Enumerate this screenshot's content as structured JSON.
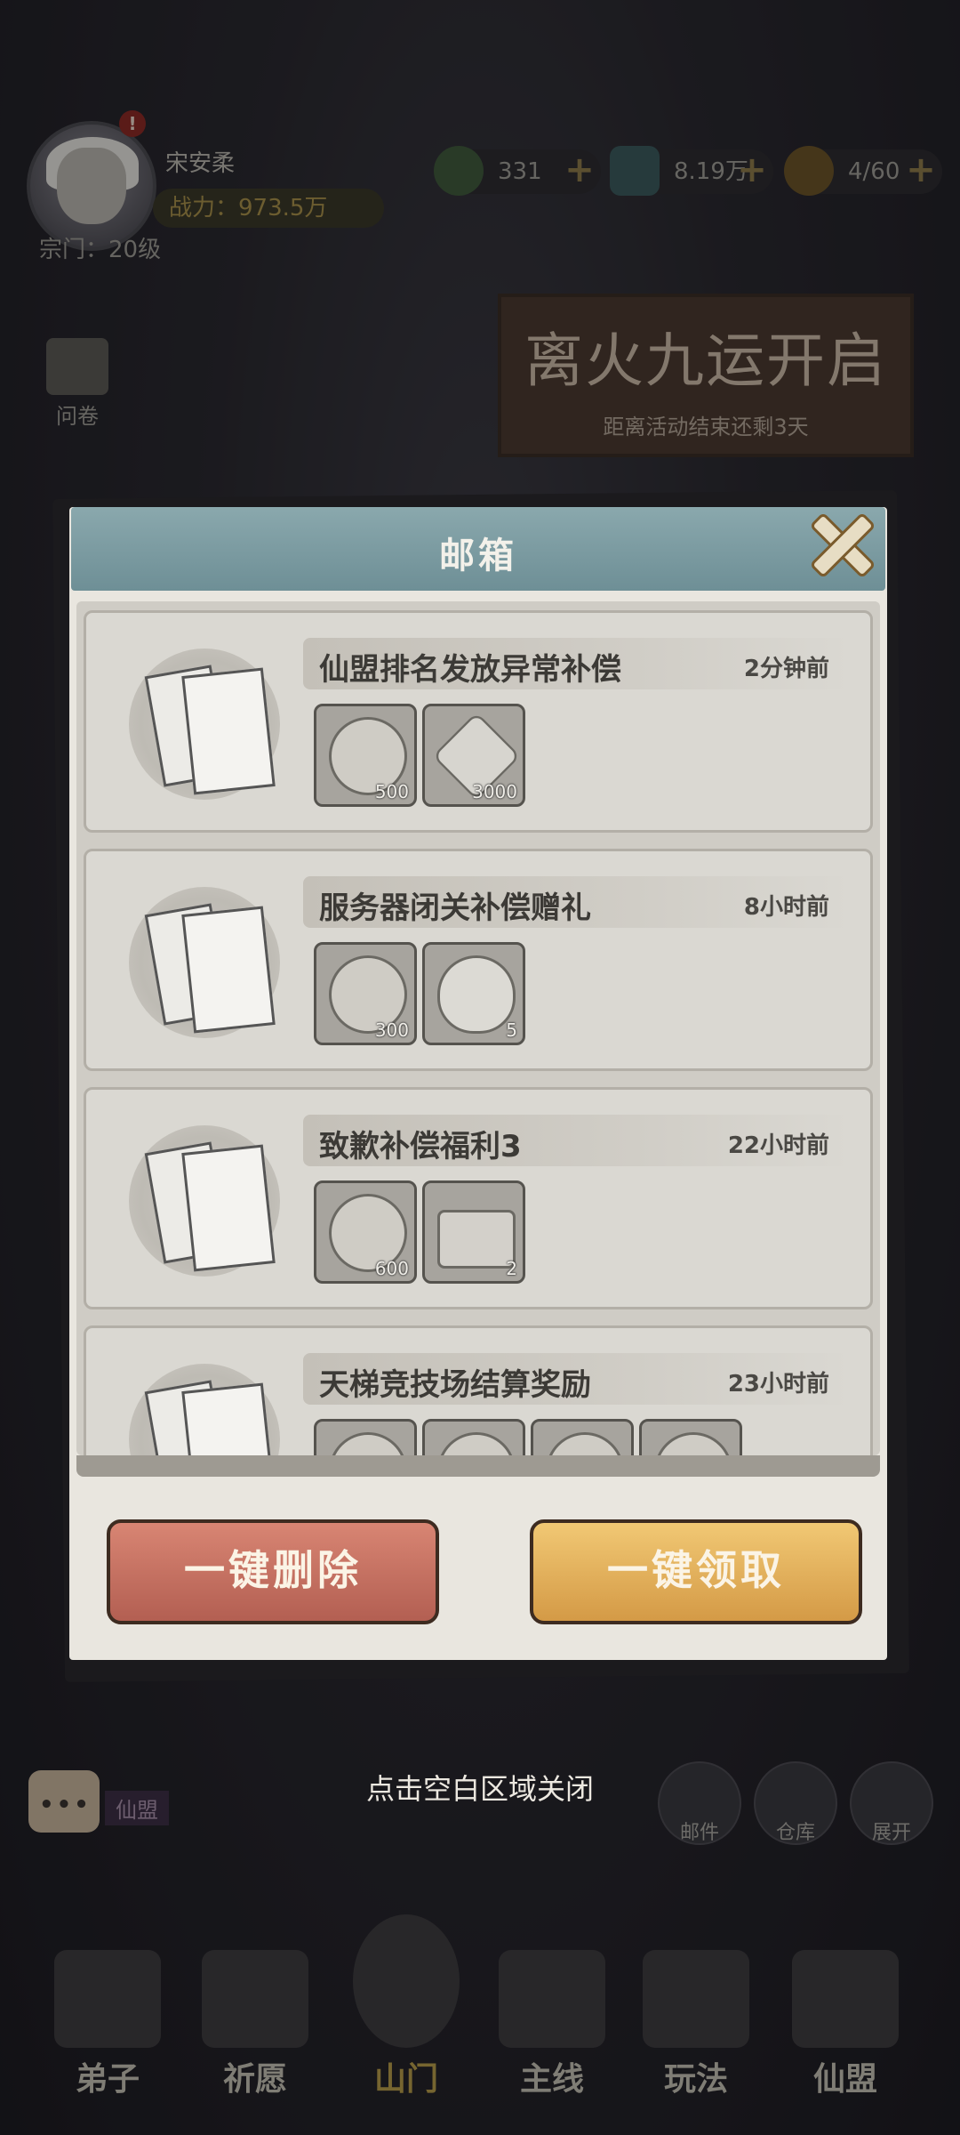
{
  "player": {
    "name": "宋安柔",
    "power": "战力：973.5万",
    "sect_level": "宗门：20级",
    "alert": "!"
  },
  "resources": [
    {
      "icon": "jade-coin-icon",
      "value": "331"
    },
    {
      "icon": "spirit-stone-icon",
      "value": "8.19万"
    },
    {
      "icon": "flame-energy-icon",
      "value": "4/60"
    }
  ],
  "event_banner": {
    "title": "离火九运开启",
    "subtitle": "距离活动结束还剩3天"
  },
  "side_menu": [
    {
      "label": "问卷"
    }
  ],
  "mailbox": {
    "title": "邮箱",
    "mails": [
      {
        "title": "仙盟排名发放异常补偿",
        "time": "2分钟前",
        "rewards": [
          {
            "icon": "coin-icon",
            "qty": "500"
          },
          {
            "icon": "spirit-stone-icon",
            "qty": "3000"
          }
        ]
      },
      {
        "title": "服务器闭关补偿赠礼",
        "time": "8小时前",
        "rewards": [
          {
            "icon": "jade-coin-icon",
            "qty": "300"
          },
          {
            "icon": "flame-icon",
            "qty": "5"
          }
        ]
      },
      {
        "title": "致歉补偿福利3",
        "time": "22小时前",
        "rewards": [
          {
            "icon": "jade-coin-icon",
            "qty": "600"
          },
          {
            "icon": "treasure-chest-icon",
            "qty": "2"
          }
        ]
      },
      {
        "title": "天梯竞技场结算奖励",
        "time": "23小时前",
        "rewards": [
          {
            "icon": "reward-icon",
            "qty": ""
          },
          {
            "icon": "reward-icon",
            "qty": ""
          },
          {
            "icon": "reward-icon",
            "qty": ""
          },
          {
            "icon": "reward-icon",
            "qty": ""
          }
        ]
      }
    ],
    "delete_all": "一键删除",
    "claim_all": "一键领取"
  },
  "close_hint": "点击空白区域关闭",
  "chat": {
    "dots": "•••",
    "channel": "仙盟"
  },
  "quick_buttons": [
    {
      "label": "邮件"
    },
    {
      "label": "仓库"
    },
    {
      "label": "展开"
    }
  ],
  "bottom_nav": [
    {
      "label": "弟子"
    },
    {
      "label": "祈愿"
    },
    {
      "label": "山门"
    },
    {
      "label": "主线"
    },
    {
      "label": "玩法"
    },
    {
      "label": "仙盟"
    }
  ],
  "colors": {
    "delete_button": "#c77566",
    "claim_button": "#e4b55e",
    "header": "#7e9ca2"
  }
}
